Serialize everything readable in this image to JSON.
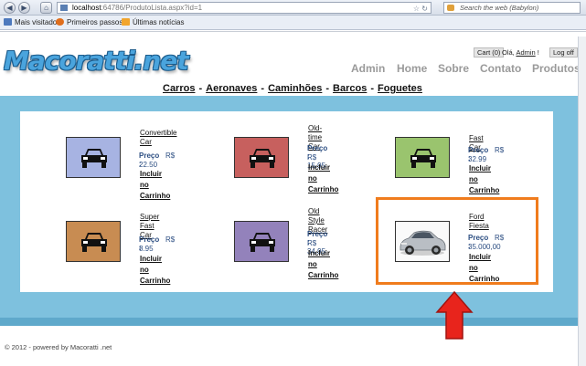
{
  "browser": {
    "url_host": "localhost",
    "url_path": ":64786/ProdutoLista.aspx?id=1",
    "search_placeholder": "Search the web (Babylon)",
    "bookmarks": [
      "Mais visitados",
      "Primeiros passos",
      "Últimas notícias"
    ]
  },
  "site": {
    "logo": "Macoratti.net",
    "cart_label": "Cart (0)",
    "hello_prefix": "Olá,",
    "hello_user": "Admin",
    "hello_suffix": "!",
    "logoff_label": "Log off",
    "main_menu": [
      "Admin",
      "Home",
      "Sobre",
      "Contato",
      "Produtos"
    ],
    "categories": [
      "Carros",
      "Aeronaves",
      "Caminhões",
      "Barcos",
      "Foguetes"
    ],
    "category_separator": "-",
    "footer": "© 2012 - powered by Macoratti .net"
  },
  "products": [
    {
      "name_l1": "Convertible",
      "name_l2": "Car",
      "price_label": "Preço :",
      "currency": "R$",
      "price": "22.50",
      "add_l1": "Incluir no",
      "add_l2": "Carrinho",
      "thumb_color": "#a7b3e2",
      "image": "car-icon"
    },
    {
      "name_l1": "Old-time",
      "name_l2": "Car",
      "price_label": "Preço :",
      "currency": "R$",
      "price": "15.95",
      "add_l1": "Incluir",
      "add_l2": "no",
      "add_l3": "Carrinho",
      "thumb_color": "#c7605e",
      "image": "car-icon"
    },
    {
      "name_l1": "Fast Car",
      "price_label": "Preço :",
      "currency": "R$",
      "price": "32.99",
      "add_l1": "Incluir no",
      "add_l2": "Carrinho",
      "thumb_color": "#9ac46e",
      "image": "car-icon"
    },
    {
      "name_l1": "Super Fast",
      "name_l2": "Car",
      "price_label": "Preço :",
      "currency": "R$",
      "price": "8.95",
      "add_l1": "Incluir no",
      "add_l2": "Carrinho",
      "thumb_color": "#c88c52",
      "image": "car-icon"
    },
    {
      "name_l1": "Old Style",
      "name_l2": "Racer",
      "price_label": "Preço :",
      "currency": "R$",
      "price": "34.95",
      "add_l1": "Incluir",
      "add_l2": "no",
      "add_l3": "Carrinho",
      "thumb_color": "#9382bb",
      "image": "car-icon"
    },
    {
      "name_l1": "Ford",
      "name_l2": "Fiesta",
      "price_label": "Preço :",
      "currency": "R$",
      "price": "35.000,00",
      "add_l1": "Incluir no",
      "add_l2": "Carrinho",
      "thumb_color": "#ffffff",
      "image": "ford-fiesta-photo"
    }
  ],
  "annotation_colors": {
    "highlight": "#f07c1d",
    "arrow": "#e8241c"
  }
}
